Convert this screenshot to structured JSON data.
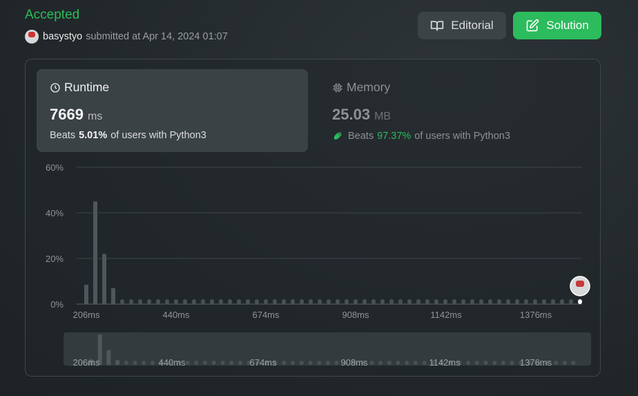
{
  "submission": {
    "status": "Accepted",
    "username": "basystyo",
    "submitted_text": "submitted at Apr 14, 2024 01:07"
  },
  "buttons": {
    "editorial": "Editorial",
    "solution": "Solution"
  },
  "runtime": {
    "title": "Runtime",
    "value": "7669",
    "unit": "ms",
    "beats_prefix": "Beats",
    "beats_pct": "5.01%",
    "beats_suffix": "of users with Python3"
  },
  "memory": {
    "title": "Memory",
    "value": "25.03",
    "unit": "MB",
    "beats_prefix": "Beats",
    "beats_pct": "97.37%",
    "beats_suffix": "of users with Python3"
  },
  "colors": {
    "accepted": "#2cbb5d",
    "button_secondary": "#3c4347",
    "bar": "#50575b"
  },
  "icons": [
    "book-icon",
    "edit-icon",
    "clock-icon",
    "chip-icon",
    "clap-icon",
    "avatar"
  ],
  "chart_data": {
    "type": "bar",
    "ylabel_ticks": [
      "0%",
      "20%",
      "40%",
      "60%"
    ],
    "ylim": [
      0,
      60
    ],
    "xtick_labels": [
      "206ms",
      "440ms",
      "674ms",
      "908ms",
      "1142ms",
      "1376ms"
    ],
    "values": [
      8.5,
      45,
      22,
      7,
      0,
      0,
      0,
      0,
      0,
      0,
      0,
      0,
      0,
      0,
      0,
      0,
      0,
      0,
      0,
      0,
      0,
      0,
      0,
      0,
      0,
      0,
      0,
      0,
      0,
      0,
      0,
      0,
      0,
      0,
      0,
      0,
      0,
      0,
      0,
      0,
      0,
      0,
      0,
      0,
      0,
      0,
      0,
      0,
      0,
      0,
      0,
      0,
      0,
      0,
      0,
      0
    ],
    "highlight_index": 55,
    "grid": true
  }
}
